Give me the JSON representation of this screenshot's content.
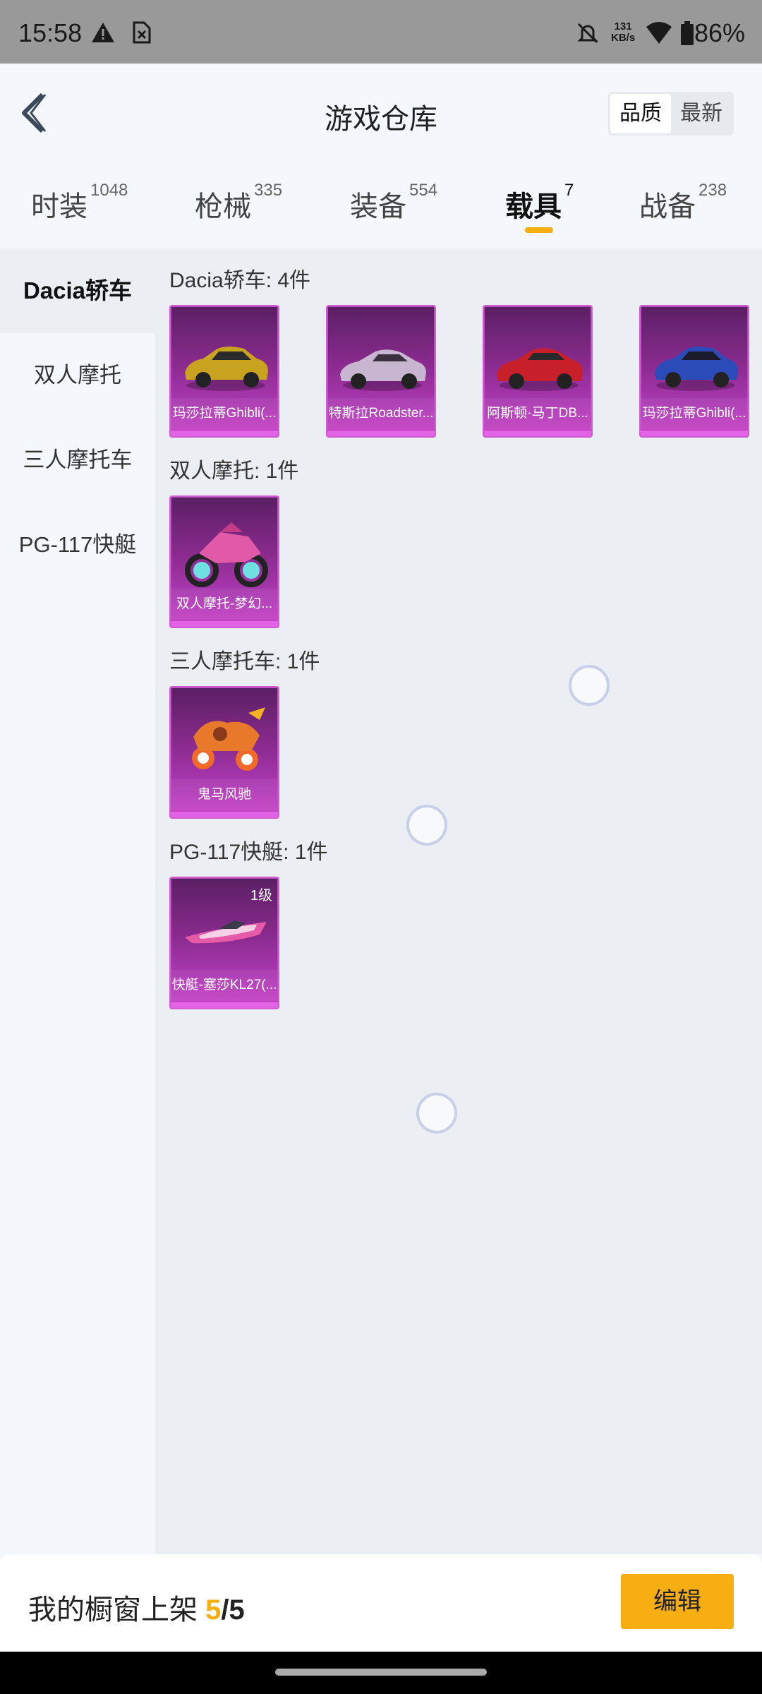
{
  "status_bar": {
    "time": "15:58",
    "net_speed_value": "131",
    "net_speed_unit": "KB/s",
    "battery": "86%"
  },
  "header": {
    "title": "游戏仓库",
    "sort_options": [
      "品质",
      "最新"
    ],
    "sort_active": "品质"
  },
  "tabs": [
    {
      "label": "时装",
      "count": "1048"
    },
    {
      "label": "枪械",
      "count": "335"
    },
    {
      "label": "装备",
      "count": "554"
    },
    {
      "label": "载具",
      "count": "7"
    },
    {
      "label": "战备",
      "count": "238"
    }
  ],
  "active_tab": "载具",
  "sidebar": {
    "items": [
      "Dacia轿车",
      "双人摩托",
      "三人摩托车",
      "PG-117快艇"
    ],
    "active": "Dacia轿车"
  },
  "sections": [
    {
      "title": "Dacia轿车: 4件",
      "items": [
        {
          "name": "玛莎拉蒂Ghibli(...",
          "icon": "gold-sedan"
        },
        {
          "name": "特斯拉Roadster...",
          "icon": "silver-roadster"
        },
        {
          "name": "阿斯顿·马丁DB...",
          "icon": "red-coupe"
        },
        {
          "name": "玛莎拉蒂Ghibli(...",
          "icon": "blue-sedan"
        }
      ]
    },
    {
      "title": "双人摩托: 1件",
      "items": [
        {
          "name": "双人摩托-梦幻...",
          "icon": "pink-motorcycle"
        }
      ]
    },
    {
      "title": "三人摩托车: 1件",
      "items": [
        {
          "name": "鬼马风驰",
          "icon": "orange-trike"
        }
      ]
    },
    {
      "title": "PG-117快艇: 1件",
      "items": [
        {
          "name": "快艇-塞莎KL27(...",
          "icon": "pink-speedboat",
          "level": "1级"
        }
      ]
    }
  ],
  "footer": {
    "label": "我的橱窗上架",
    "current": "5",
    "separator": "/",
    "total": "5",
    "edit_button": "编辑"
  },
  "colors": {
    "accent": "#f6ae12",
    "card_purple": "#8a2b8f",
    "card_border": "#d05ad2"
  }
}
